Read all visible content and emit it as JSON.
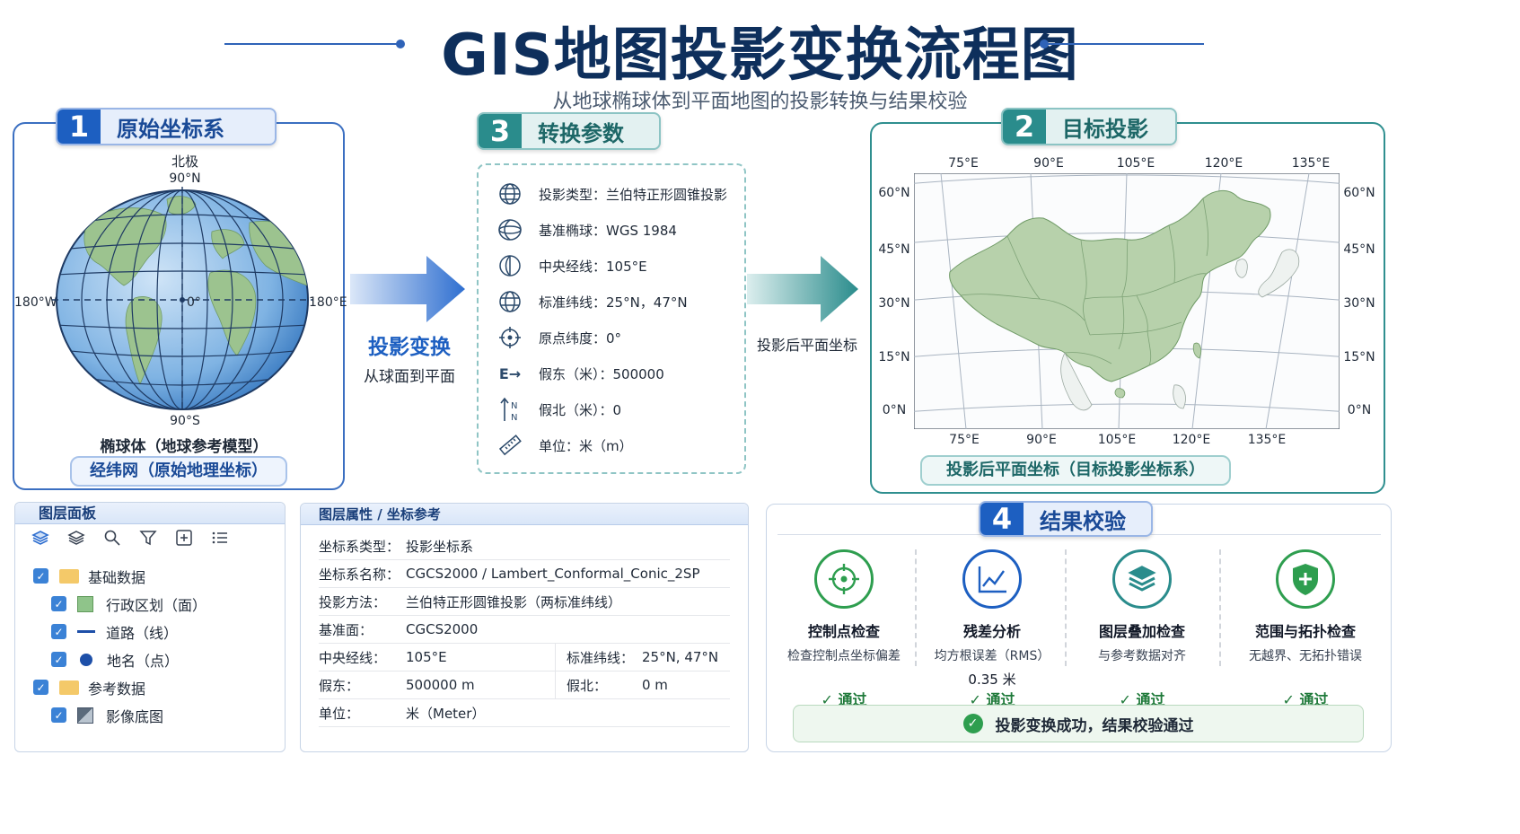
{
  "title": "GIS地图投影变换流程图",
  "subtitle": "从地球椭球体到平面地图的投影转换与结果校验",
  "colors": {
    "navy": "#0e2f5c",
    "blue": "#1d5fc1",
    "teal": "#2a8c8c",
    "land": "#9cc38f",
    "ocean": "#7fb3e3",
    "pass_green": "#2e9e4f"
  },
  "section1": {
    "number": "1",
    "title": "原始坐标系",
    "north_pole": "北极",
    "lat_top": "90°N",
    "lat_bottom": "90°S",
    "lon_left": "180°W",
    "lon_right": "180°E",
    "center": "0°",
    "caption": "椭球体（地球参考模型）",
    "pill": "经纬网（原始地理坐标）"
  },
  "arrow1": {
    "title": "投影变换",
    "subtitle": "从球面到平面"
  },
  "section3": {
    "number": "3",
    "title": "转换参数",
    "params": [
      {
        "icon": "globe-grid-icon",
        "text": "投影类型：兰伯特正形圆锥投影"
      },
      {
        "icon": "ellipsoid-icon",
        "text": "基准椭球：WGS 1984"
      },
      {
        "icon": "meridian-icon",
        "text": "中央经线：105°E"
      },
      {
        "icon": "parallels-icon",
        "text": "标准纬线：25°N，47°N"
      },
      {
        "icon": "crosshair-icon",
        "text": "原点纬度：0°"
      },
      {
        "icon": "false-easting-icon",
        "text": "假东（米）：500000"
      },
      {
        "icon": "false-northing-icon",
        "text": "假北（米）：0"
      },
      {
        "icon": "ruler-icon",
        "text": "单位：米（m）"
      }
    ],
    "easting_glyph": "E→",
    "northing_glyph": "N"
  },
  "arrow2": {
    "label": "投影后平面坐标"
  },
  "section2": {
    "number": "2",
    "title": "目标投影",
    "lon_top": [
      "75°E",
      "90°E",
      "105°E",
      "120°E",
      "135°E"
    ],
    "lon_bottom": [
      "75°E",
      "90°E",
      "105°E",
      "120°E",
      "135°E"
    ],
    "lat_left": [
      "60°N",
      "45°N",
      "30°N",
      "15°N",
      "0°N"
    ],
    "lat_right": [
      "60°N",
      "45°N",
      "30°N",
      "15°N",
      "0°N"
    ],
    "pill": "投影后平面坐标（目标投影坐标系）"
  },
  "layer_panel": {
    "title": "图层面板",
    "toolbar": [
      "layers-icon",
      "stack-icon",
      "search-icon",
      "filter-icon",
      "add-layer-icon",
      "list-icon"
    ],
    "items": [
      {
        "label": "基础数据",
        "level": 0,
        "icon": "folder-icon"
      },
      {
        "label": "行政区划（面）",
        "level": 1,
        "icon": "polygon-swatch-icon"
      },
      {
        "label": "道路（线）",
        "level": 1,
        "icon": "line-swatch-icon"
      },
      {
        "label": "地名（点）",
        "level": 1,
        "icon": "point-swatch-icon"
      },
      {
        "label": "参考数据",
        "level": 0,
        "icon": "folder-icon"
      },
      {
        "label": "影像底图",
        "level": 1,
        "icon": "raster-swatch-icon"
      }
    ]
  },
  "attr_panel": {
    "title": "图层属性 / 坐标参考",
    "rows": [
      {
        "k": "坐标系类型：",
        "v": "投影坐标系"
      },
      {
        "k": "坐标系名称：",
        "v": "CGCS2000 / Lambert_Conformal_Conic_2SP"
      },
      {
        "k": "投影方法：",
        "v": "兰伯特正形圆锥投影（两标准纬线）"
      },
      {
        "k": "基准面：",
        "v": "CGCS2000"
      }
    ],
    "pair_rows": [
      {
        "k1": "中央经线：",
        "v1": "105°E",
        "k2": "标准纬线：",
        "v2": "25°N, 47°N"
      },
      {
        "k1": "假东：",
        "v1": "500000  m",
        "k2": "假北：",
        "v2": "0  m"
      }
    ],
    "last_row": {
      "k": "单位：",
      "v": "米（Meter）"
    }
  },
  "section4": {
    "number": "4",
    "title": "结果校验",
    "checks": [
      {
        "icon": "crosshair-icon",
        "title": "控制点检查",
        "desc": "检查控制点坐标偏差",
        "extra": "",
        "pass": "通过",
        "color": "#2e9e4f"
      },
      {
        "icon": "chart-icon",
        "title": "残差分析",
        "desc": "均方根误差（RMS）",
        "extra": "0.35 米",
        "pass": "通过",
        "color": "#1d5fc1"
      },
      {
        "icon": "stack-icon",
        "title": "图层叠加检查",
        "desc": "与参考数据对齐",
        "extra": "",
        "pass": "通过",
        "color": "#2a8c8c"
      },
      {
        "icon": "shield-plus-icon",
        "title": "范围与拓扑检查",
        "desc": "无越界、无拓扑错误",
        "extra": "",
        "pass": "通过",
        "color": "#2e9e4f"
      }
    ],
    "success": "投影变换成功，结果校验通过"
  }
}
